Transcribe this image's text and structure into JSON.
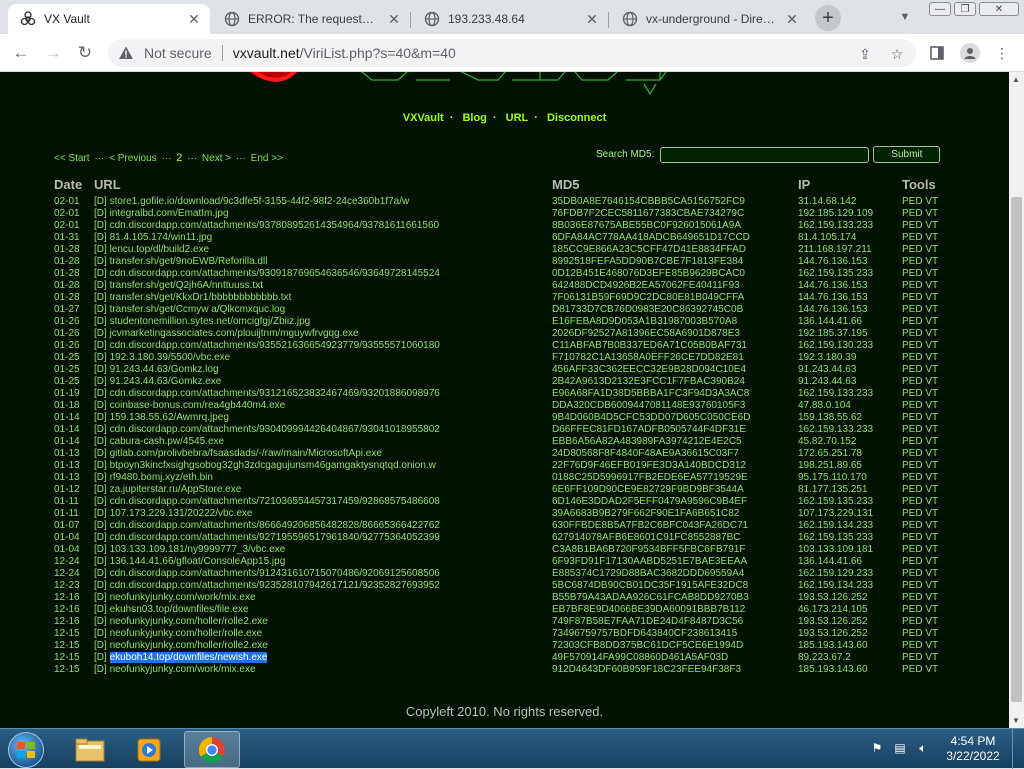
{
  "browser": {
    "tabs": [
      {
        "title": "VX Vault",
        "favicon": "biohazard-icon",
        "active": true
      },
      {
        "title": "ERROR: The requested URL",
        "favicon": "globe-icon",
        "active": false
      },
      {
        "title": "193.233.48.64",
        "favicon": "globe-icon",
        "active": false
      },
      {
        "title": "vx-underground - Directory",
        "favicon": "globe-icon",
        "active": false
      }
    ],
    "new_tab_label": "+",
    "security_label": "Not secure",
    "url_host": "vxvault.net",
    "url_path": "/ViriList.php?s=40&m=40"
  },
  "site": {
    "nav": [
      "VXVault",
      "Blog",
      "URL",
      "Disconnect"
    ],
    "pager": {
      "first": "<< Start",
      "prev": "< Previous",
      "ellipsis": "···",
      "current": "2",
      "next": "Next >",
      "last": "End >>"
    },
    "search_label": "Search MD5:",
    "search_value": "",
    "submit_label": "Submit",
    "headers": {
      "date": "Date",
      "url": "URL",
      "md5": "MD5",
      "ip": "IP",
      "tools": "Tools"
    },
    "rows": [
      {
        "date": "02-01",
        "url": "store1.gofile.io/download/9c3dfe5f-3155-44f2-98f2-24ce360b1f7a/w",
        "md5": "35DB0A8E7646154CBBB5CA5156752FC9",
        "ip": "31.14.68.142"
      },
      {
        "date": "02-01",
        "url": "integralbd.com/EmatIm.jpg",
        "md5": "76FDB7F2CEC5811677383CBAE734279C",
        "ip": "192.185.129.109"
      },
      {
        "date": "02-01",
        "url": "cdn.discordapp.com/attachments/937808952614354964/93781611661560",
        "md5": "8B036E87675ABE55BC0F926015061A9A",
        "ip": "162.159.133.233"
      },
      {
        "date": "01-31",
        "url": "81.4.105.174/win11.jpg",
        "md5": "6DFA84AC778AA418ADCB649651D17CCD",
        "ip": "81.4.105.174"
      },
      {
        "date": "01-28",
        "url": "lencu.top/dl/build2.exe",
        "md5": "185CC9E866A23C5CFF47D41E8834FFAD",
        "ip": "211.168.197.211"
      },
      {
        "date": "01-28",
        "url": "transfer.sh/get/9noEWB/Reforilla.dll",
        "md5": "8992518FEFA5DD90B7CBE7F1813FE384",
        "ip": "144.76.136.153"
      },
      {
        "date": "01-28",
        "url": "cdn.discordapp.com/attachments/930918769654636546/93649728145524",
        "md5": "0D12B451E468076D3EFE85B9629BCAC0",
        "ip": "162.159.135.233"
      },
      {
        "date": "01-28",
        "url": "transfer.sh/get/Q2jh6A/nnttuuss.txt",
        "md5": "642488DCD4926B2EA57062FE40411F93",
        "ip": "144.76.136.153"
      },
      {
        "date": "01-28",
        "url": "transfer.sh/get/KkxDr1/bbbbbbbbbbbb.txt",
        "md5": "7F06131B59F69D9C2DC80E81B049CFFA",
        "ip": "144.76.136.153"
      },
      {
        "date": "01-27",
        "url": "transfer.sh/get/Ccmyw a/Qlkcmxquc.log",
        "md5": "D81733D7CB76D0983E20C86392745C0B",
        "ip": "144.76.136.153"
      },
      {
        "date": "01-26",
        "url": "studentonemillion.sytes.net/omcigfgj/Zbiiz.jpg",
        "md5": "E16FEBA8D9D053A1B31987003B570A8",
        "ip": "136.144.41.66"
      },
      {
        "date": "01-26",
        "url": "jcvmarketingassociates.com/plouijtnm/mguywfrvgqg.exe",
        "md5": "2026DF92527A81396EC58A6901D878E3",
        "ip": "192.185.37.195"
      },
      {
        "date": "01-26",
        "url": "cdn.discordapp.com/attachments/935521636654923779/93555571060180",
        "md5": "C11ABFAB7B0B337ED6A71C05B0BAF731",
        "ip": "162.159.130.233"
      },
      {
        "date": "01-25",
        "url": "192.3.180.39/5500/vbc.exe",
        "md5": "F710782C1A13658A0EFF26CE7DD82E81",
        "ip": "192.3.180.39"
      },
      {
        "date": "01-25",
        "url": "91.243.44.63/Gomkz.log",
        "md5": "456AFF33C362EECC32E9B28D094C10E4",
        "ip": "91.243.44.63"
      },
      {
        "date": "01-25",
        "url": "91.243.44.63/Gomkz.exe",
        "md5": "2B42A9613D2132E3FCC1F7FBAC390B24",
        "ip": "91.243.44.63"
      },
      {
        "date": "01-19",
        "url": "cdn.discordapp.com/attachments/931216523832467469/93201886098976",
        "md5": "E96A68FA1D38D5BBBA1FC3F94D3A3AC8",
        "ip": "162.159.133.233"
      },
      {
        "date": "01-18",
        "url": "coinbase-bonus.com/rea4gb440m4.exe",
        "md5": "DDA320CDB6009447081148E93760105F3",
        "ip": "47.88.0.104"
      },
      {
        "date": "01-14",
        "url": "159.138.55.62/Awmrq.jpeg",
        "md5": "9B4D060B4D5CFC53DD07D605C050CE6D",
        "ip": "159.138.55.62"
      },
      {
        "date": "01-14",
        "url": "cdn.discordapp.com/attachments/930409994426404867/93041018955802",
        "md5": "D66FFEC81FD167ADFB0505744F4DF31E",
        "ip": "162.159.133.233"
      },
      {
        "date": "01-14",
        "url": "cabura-cash.pw/4545.exe",
        "md5": "EBB6A56A82A483989FA3974212E4E2C5",
        "ip": "45.82.70.152"
      },
      {
        "date": "01-13",
        "url": "gitlab.com/prolivbebra/fsaasdads/-/raw/main/MicrosoftApi.exe",
        "md5": "24D80568F8F4840F48AE9A36615C03F7",
        "ip": "172.65.251.78"
      },
      {
        "date": "01-13",
        "url": "btpoyn3kincfxsighgsobog32gh3zdcgagujunsm46gamgaktysnqtqd.onion.w",
        "md5": "22F76D9F46EFB019FE3D3A140BDCD312",
        "ip": "198.251.89.65"
      },
      {
        "date": "01-13",
        "url": "rf9480.bomj.xyz/eth.bin",
        "md5": "0188C25D5996917FB2EDE6EA57719529E",
        "ip": "95.175.110.170"
      },
      {
        "date": "01-12",
        "url": "za.jupiterstar.ru/AppStore.exe",
        "md5": "6E6FF109D90CE9E82729F9BD9BF3544A",
        "ip": "81.177.135.251"
      },
      {
        "date": "01-11",
        "url": "cdn.discordapp.com/attachments/721036554457317459/92868575486608",
        "md5": "6D146E3DDAD2F5EFF0479A9596C9B4EF",
        "ip": "162.159.135.233"
      },
      {
        "date": "01-11",
        "url": "107.173.229.131/20222/vbc.exe",
        "md5": "39A6683B9B279F662F90E1FA6B651C82",
        "ip": "107.173.229.131"
      },
      {
        "date": "01-07",
        "url": "cdn.discordapp.com/attachments/866649206856482828/86665366422762",
        "md5": "630FFBDE8B5A7FB2C6BFC043FA26DC71",
        "ip": "162.159.134.233"
      },
      {
        "date": "01-04",
        "url": "cdn.discordapp.com/attachments/927195596517961840/92775364052399",
        "md5": "627914078AFB6E8601C91FC8552887BC",
        "ip": "162.159.135.233"
      },
      {
        "date": "01-04",
        "url": "103.133.109.181/ny9999777_3/vbc.exe",
        "md5": "C3A8B1BA6B720F9534BFF5FBC6FB791F",
        "ip": "103.133.109.181"
      },
      {
        "date": "12-24",
        "url": "136.144.41.66/gfloat/ConsoleApp15.jpg",
        "md5": "6F93FD91F17130AABD5251E7BAE3EEAA",
        "ip": "136.144.41.66"
      },
      {
        "date": "12-24",
        "url": "cdn.discordapp.com/attachments/912431610715070486/92069125608506",
        "md5": "E885374C1729D88BAC3682DDD69559A4",
        "ip": "162.159.129.233"
      },
      {
        "date": "12-23",
        "url": "cdn.discordapp.com/attachments/923528107942617121/92352827693952",
        "md5": "5BC6874DB90CB01DC35F1915AFE32DC8",
        "ip": "162.159.134.233"
      },
      {
        "date": "12-16",
        "url": "neofunkyjunky.com/work/mix.exe",
        "md5": "B55B79A43ADAA926C61FCAB8DD9270B3",
        "ip": "193.53.126.252"
      },
      {
        "date": "12-16",
        "url": "ekuhsn03.top/downfiles/file.exe",
        "md5": "EB7BF8E9D4066BE39DA60091BBB7B112",
        "ip": "46.173.214.105"
      },
      {
        "date": "12-16",
        "url": "neofunkyjunky.com/holler/rolle2.exe",
        "md5": "749F87B58E7FAA71DE24D4F8487D3C56",
        "ip": "193.53.126.252"
      },
      {
        "date": "12-15",
        "url": "neofunkyjunky.com/holler/rolle.exe",
        "md5": "73496759757BDFD643840CF238613415",
        "ip": "193.53.126.252"
      },
      {
        "date": "12-15",
        "url": "neofunkyjunky.com/holler/rolle2.exe",
        "md5": "72303CFB8DD375BC61DCF5CE6E1994D",
        "ip": "185.193.143.60"
      },
      {
        "date": "12-15",
        "url": "ekuboh14.top/downfiles/newish.exe",
        "md5": "49F570914FA99C08860D461A5AF03D",
        "ip": "89.223.67.2",
        "selected": true
      },
      {
        "date": "12-15",
        "url": "neofunkyjunky.com/work/mix.exe",
        "md5": "912D4643DF60B959F18C23FEE94F38F3",
        "ip": "185.193.143.60"
      }
    ],
    "row_prefix": "[D]",
    "tools": "PED VT",
    "footer": "Copyleft 2010. No rights reserved."
  },
  "taskbar": {
    "time": "4:54 PM",
    "date": "3/22/2022"
  }
}
